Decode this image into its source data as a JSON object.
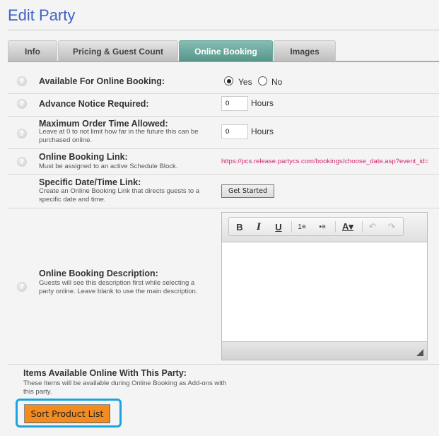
{
  "page": {
    "title": "Edit Party"
  },
  "tabs": [
    {
      "label": "Info",
      "active": false
    },
    {
      "label": "Pricing & Guest Count",
      "active": false
    },
    {
      "label": "Online Booking",
      "active": true
    },
    {
      "label": "Images",
      "active": false
    }
  ],
  "colors": {
    "title": "#3f62c4",
    "active_tab": "#55958a",
    "link": "#d2286f",
    "sort_button": "#f38b1e",
    "highlight": "#19a4e0"
  },
  "form": {
    "available": {
      "label": "Available For Online Booking:",
      "options": [
        "Yes",
        "No"
      ],
      "selected": "Yes"
    },
    "advance_notice": {
      "label": "Advance Notice Required:",
      "value": "0",
      "unit": "Hours"
    },
    "max_order": {
      "label": "Maximum Order Time Allowed:",
      "help": "Leave at 0 to not limit how far in the future this can be purchased online.",
      "value": "0",
      "unit": "Hours"
    },
    "booking_link": {
      "label": "Online Booking Link:",
      "help": "Must be assigned to an active Schedule Block.",
      "url": "https://pcs.release.partycs.com/bookings/choose_date.asp?event_id="
    },
    "specific_link": {
      "label": "Specific Date/Time Link:",
      "help": "Create an Online Booking Link that directs guests to a specific date and time.",
      "button": "Get Started"
    },
    "description": {
      "label": "Online Booking Description:",
      "help": "Guests will see this description first while selecting a party online. Leave blank to use the main description.",
      "value": ""
    },
    "items": {
      "label": "Items Available Online With This Party:",
      "help": "These Items will be available during Online Booking as Add-ons with this party.",
      "button": "Sort Product List"
    }
  },
  "editor_toolbar": {
    "bold": "B",
    "italic": "I",
    "underline": "U",
    "ordered_list": "1≡",
    "bullet_list": "•≡",
    "font_color": "A▾",
    "undo": "↶",
    "redo": "↷"
  }
}
